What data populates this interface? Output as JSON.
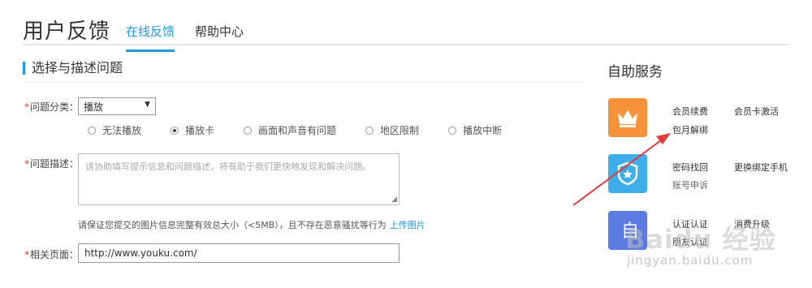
{
  "header": {
    "title": "用户反馈",
    "tabs": [
      {
        "label": "在线反馈",
        "active": true
      },
      {
        "label": "帮助中心",
        "active": false
      }
    ]
  },
  "form": {
    "section_title": "选择与描述问题",
    "required_mark": "*",
    "category": {
      "label": "问题分类：",
      "selected": "播放",
      "options": [
        "无法播放",
        "播放卡",
        "画面和声音有问题",
        "地区限制",
        "播放中断"
      ],
      "checked_index": 1
    },
    "description": {
      "label": "问题描述：",
      "placeholder": "请协助填写提示信息和问题描述，将有助于我们更快地发现和解决问题。"
    },
    "upload_hint": "请保证您提交的图片信息完整有效总大小（<5MB），且不存在恶意骚扰等行为",
    "upload_link": "上传图片",
    "related_page": {
      "label": "相关页面：",
      "value": "http://www.youku.com/"
    }
  },
  "sidebar": {
    "title": "自助服务",
    "groups": [
      {
        "icon": "crown-icon",
        "color": "#f5933a",
        "links": [
          "会员续费",
          "会员卡激活",
          "包月解绑"
        ]
      },
      {
        "icon": "shield-star-icon",
        "color": "#3daee9",
        "links": [
          "密码找回",
          "更换绑定手机",
          "账号申诉"
        ]
      },
      {
        "icon": "id-card-icon",
        "color": "#5b7be0",
        "links": [
          "认证认证",
          "消费升级",
          "朋友认证"
        ]
      }
    ]
  },
  "watermark": {
    "text": "Baidu 经验",
    "url": "jingyan.baidu.com"
  },
  "colors": {
    "accent": "#1f9ae0",
    "required": "#e4393c",
    "arrow": "#e03a3a"
  }
}
